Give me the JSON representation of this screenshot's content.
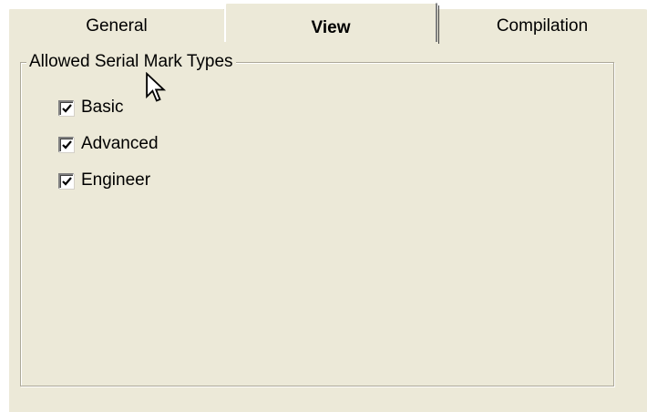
{
  "tabs": [
    {
      "label": "General",
      "selected": false
    },
    {
      "label": "View",
      "selected": true
    },
    {
      "label": "Compilation",
      "selected": false
    }
  ],
  "group": {
    "title": "Allowed Serial Mark Types",
    "options": [
      {
        "label": "Basic",
        "checked": true
      },
      {
        "label": "Advanced",
        "checked": true
      },
      {
        "label": "Engineer",
        "checked": true
      }
    ]
  },
  "cursor": {
    "icon": "arrow-cursor-icon"
  },
  "colors": {
    "panel_background": "#ece9d8",
    "groupbox_border": "#aca899",
    "text": "#000000"
  }
}
